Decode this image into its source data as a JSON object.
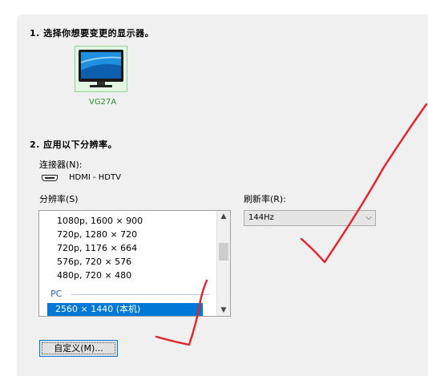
{
  "step1": {
    "heading": "1. 选择你想要变更的显示器。"
  },
  "monitor": {
    "label": "VG27A",
    "selected": true
  },
  "step2": {
    "heading": "2. 应用以下分辨率。"
  },
  "connector": {
    "label": "连接器(N):",
    "value": "HDMI - HDTV"
  },
  "resolution": {
    "label": "分辨率(S)",
    "items": [
      "1080p, 1600 × 900",
      "720p, 1280 × 720",
      "720p, 1176 × 664",
      "576p, 720 × 576",
      "480p, 720 × 480"
    ],
    "group_label": "PC",
    "selected_item": "2560 × 1440 (本机)"
  },
  "refresh": {
    "label": "刷新率(R):",
    "value": "144Hz"
  },
  "customize_button": {
    "label": "自定义(M)..."
  },
  "colors": {
    "selection": "#0078d7",
    "annotation_ink": "#e8202a"
  }
}
